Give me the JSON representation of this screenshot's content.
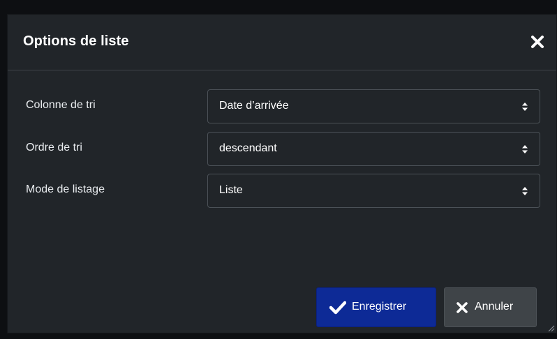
{
  "dialog": {
    "title": "Options de liste",
    "close_icon": "close-icon"
  },
  "form": {
    "rows": [
      {
        "label": "Colonne de tri",
        "value": "Date d’arrivée"
      },
      {
        "label": "Ordre de tri",
        "value": "descendant"
      },
      {
        "label": "Mode de listage",
        "value": "Liste"
      }
    ]
  },
  "buttons": {
    "save_label": "Enregistrer",
    "save_icon": "check-icon",
    "cancel_label": "Annuler",
    "cancel_icon": "close-icon"
  },
  "colors": {
    "dialog_bg": "#212529",
    "save_bg": "#0d2a96",
    "cancel_bg": "#3f4448",
    "text": "#ffffff"
  }
}
